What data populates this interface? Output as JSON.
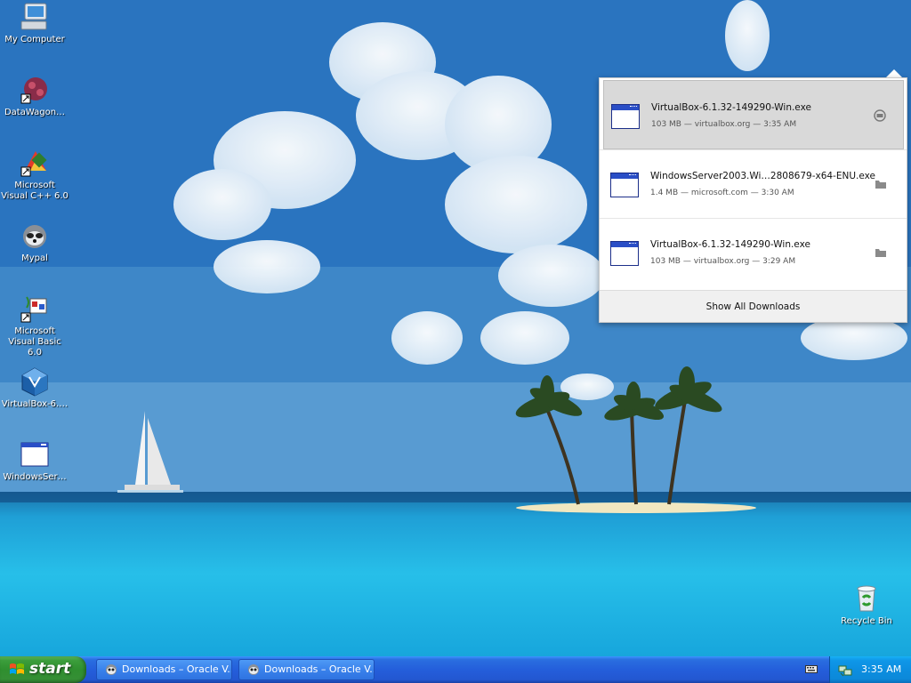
{
  "desktop": {
    "icons": [
      {
        "label": "My Computer",
        "icon": "my-computer-icon"
      },
      {
        "label": "DataWagon…",
        "icon": "datawagon-shortcut-icon"
      },
      {
        "label": "Microsoft Visual C++ 6.0",
        "icon": "visual-cpp-shortcut-icon"
      },
      {
        "label": "Mypal",
        "icon": "mypal-browser-icon"
      },
      {
        "label": "Microsoft Visual Basic 6.0",
        "icon": "visual-basic-shortcut-icon"
      },
      {
        "label": "VirtualBox-6.…",
        "icon": "virtualbox-installer-icon"
      },
      {
        "label": "WindowsSer…",
        "icon": "application-window-icon"
      },
      {
        "label": "Recycle Bin",
        "icon": "recycle-bin-icon"
      }
    ]
  },
  "downloads": {
    "items": [
      {
        "name": "VirtualBox-6.1.32-149290-Win.exe",
        "meta": "103 MB — virtualbox.org — 3:35 AM",
        "selected": true
      },
      {
        "name": "WindowsServer2003.Wi…2808679-x64-ENU.exe",
        "meta": "1.4 MB — microsoft.com — 3:30 AM",
        "selected": false
      },
      {
        "name": "VirtualBox-6.1.32-149290-Win.exe",
        "meta": "103 MB — virtualbox.org — 3:29 AM",
        "selected": false
      }
    ],
    "show_all": "Show All Downloads"
  },
  "taskbar": {
    "start_label": "start",
    "tasks": [
      {
        "label": "Downloads – Oracle V..."
      },
      {
        "label": "Downloads – Oracle V..."
      }
    ],
    "clock": "3:35 AM"
  },
  "colors": {
    "taskbar_blue": "#245edb",
    "start_green": "#3c9e3c",
    "tray_blue": "#0c8ee0",
    "selected_row": "#d9d9d9"
  }
}
